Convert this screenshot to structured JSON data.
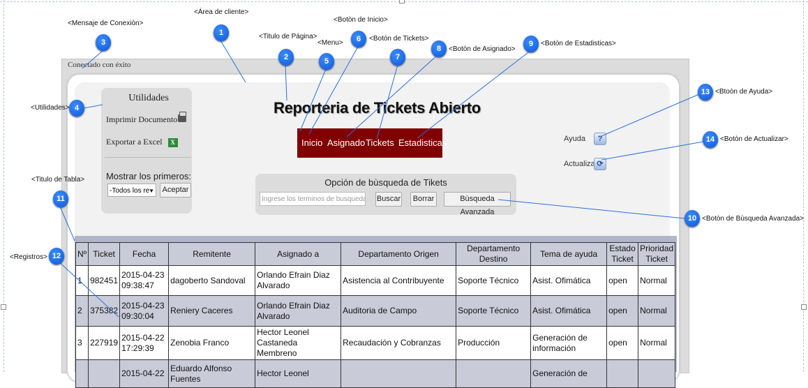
{
  "connection_message": "Conectado con éxito",
  "utilities": {
    "title": "Utilidades",
    "print": "Imprimir Documento",
    "export": "Exportar a Excel",
    "show_first_label": "Mostrar los primeros:",
    "show_first_value": "-Todos los re",
    "accept": "Aceptar"
  },
  "page_title": "Reporteria de Tickets Abierto",
  "menu": {
    "home": "Inicio",
    "assigned": "Asignado",
    "tickets": "Tickets",
    "stats": "Estadisticas"
  },
  "help": {
    "help_label": "Ayuda",
    "refresh_label": "Actualizar"
  },
  "search": {
    "title": "Opción de bùsqueda de Tikets",
    "placeholder": "Ingrese los terminos de busqueda",
    "search_btn": "Buscar",
    "clear_btn": "Borrar",
    "advanced_btn": "Bùsqueda Avanzada"
  },
  "table": {
    "headers": [
      "Nº",
      "Ticket",
      "Fecha",
      "Remitente",
      "Asignado a",
      "Departamento Origen",
      "Departamento Destino",
      "Tema de ayuda",
      "Estado Ticket",
      "Prioridad Ticket"
    ],
    "rows": [
      [
        "1",
        "982451",
        "2015-04-23 09:38:47",
        "dagoberto Sandoval",
        "Orlando Efrain Diaz Alvarado",
        "Asistencia al Contribuyente",
        "Soporte Técnico",
        "Asist. Ofimática",
        "open",
        "Normal"
      ],
      [
        "2",
        "375382",
        "2015-04-23 09:30:04",
        "Reniery Caceres",
        "Orlando Efrain Diaz Alvarado",
        "Auditoria de Campo",
        "Soporte Técnico",
        "Asist. Ofimática",
        "open",
        "Normal"
      ],
      [
        "3",
        "227919",
        "2015-04-22 17:29:39",
        "Zenobia Franco",
        "Hector Leonel Castaneda Membreno",
        "Recaudación y Cobranzas",
        "Producción",
        "Generación de información",
        "open",
        "Normal"
      ],
      [
        "",
        "",
        "2015-04-22",
        "Eduardo Alfonso Fuentes",
        "Hector Leonel",
        "",
        "",
        "Generación de",
        "",
        ""
      ]
    ]
  },
  "annotations": [
    {
      "n": "1",
      "label": "<Área de cliente>"
    },
    {
      "n": "2",
      "label": "<Titulo de Página>"
    },
    {
      "n": "3",
      "label": "<Mensaje de Conexiòn>"
    },
    {
      "n": "4",
      "label": "<Utilidades>"
    },
    {
      "n": "5",
      "label": "<Menu>"
    },
    {
      "n": "6",
      "label": "<Botòn de Inicio>"
    },
    {
      "n": "7",
      "label": "<Botòn de Tickets>"
    },
    {
      "n": "8",
      "label": "<Botòn de Asignado>"
    },
    {
      "n": "9",
      "label": "<Botòn de Estadisticas>"
    },
    {
      "n": "10",
      "label": "<Botòn de Bùsqueda Avanzada>"
    },
    {
      "n": "11",
      "label": "<Titulo de Tabla>"
    },
    {
      "n": "12",
      "label": "<Registros>"
    },
    {
      "n": "13",
      "label": "<Btoòn de Ayuda>"
    },
    {
      "n": "14",
      "label": "<Botòn de Actualizar>"
    }
  ]
}
